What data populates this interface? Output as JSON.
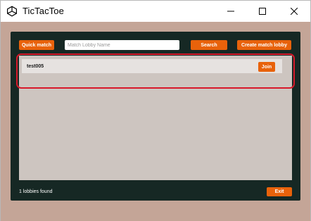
{
  "window": {
    "title": "TicTacToe",
    "icon": "unity-logo-icon",
    "controls": [
      "minimize-icon",
      "maximize-icon",
      "close-icon"
    ]
  },
  "toolbar": {
    "quick_match_label": "Quick match",
    "search_placeholder": "Match Lobby Name",
    "search_value": "",
    "search_label": "Search",
    "create_label": "Create match lobby"
  },
  "lobbies": [
    {
      "name": "test005",
      "join_label": "Join"
    }
  ],
  "footer": {
    "status": "1 lobbies found",
    "exit_label": "Exit"
  },
  "colors": {
    "accent": "#e8620b",
    "panel": "#162824",
    "background": "#c4a597",
    "list": "#cdc5c0",
    "highlight": "#d8192a"
  }
}
